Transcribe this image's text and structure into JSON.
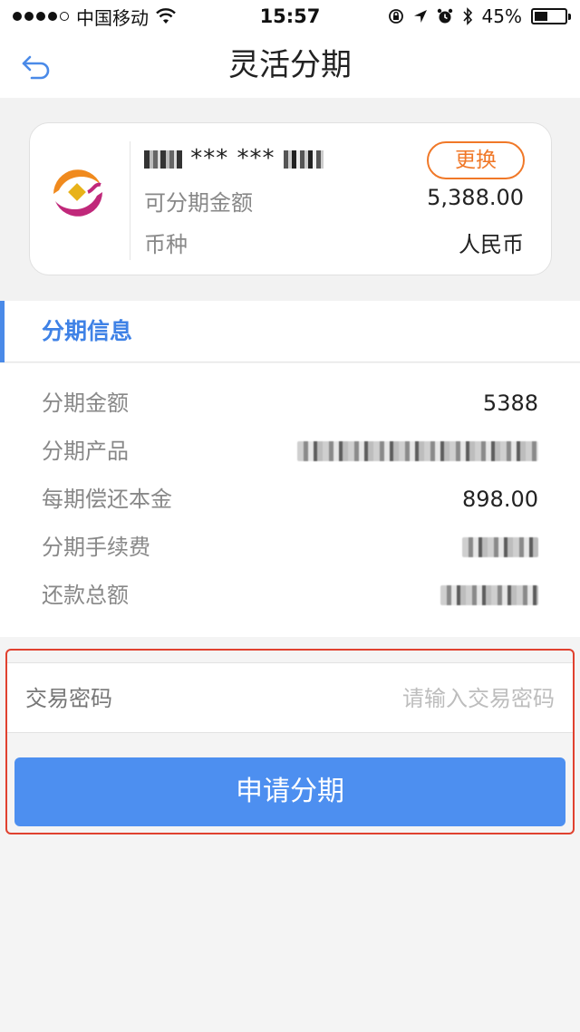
{
  "status_bar": {
    "carrier": "中国移动",
    "time": "15:57",
    "battery": "45%",
    "battery_level": 0.45
  },
  "nav": {
    "title": "灵活分期",
    "back_icon": "back-arrow-icon"
  },
  "card": {
    "number": "*** ***",
    "change_label": "更换",
    "available_label": "可分期金额",
    "available_value": "5,388.00",
    "currency_label": "币种",
    "currency_value": "人民币"
  },
  "section": {
    "title": "分期信息"
  },
  "info": [
    {
      "label": "分期金额",
      "value": "5388"
    },
    {
      "label": "分期产品",
      "value": ""
    },
    {
      "label": "每期偿还本金",
      "value": "898.00"
    },
    {
      "label": "分期手续费",
      "value": ""
    },
    {
      "label": "还款总额",
      "value": ""
    }
  ],
  "password": {
    "label": "交易密码",
    "placeholder": "请输入交易密码"
  },
  "submit_label": "申请分期",
  "colors": {
    "accent": "#4d8ff0",
    "section_title": "#3f82e6",
    "change_button": "#f07828",
    "highlight": "#e0412f"
  }
}
